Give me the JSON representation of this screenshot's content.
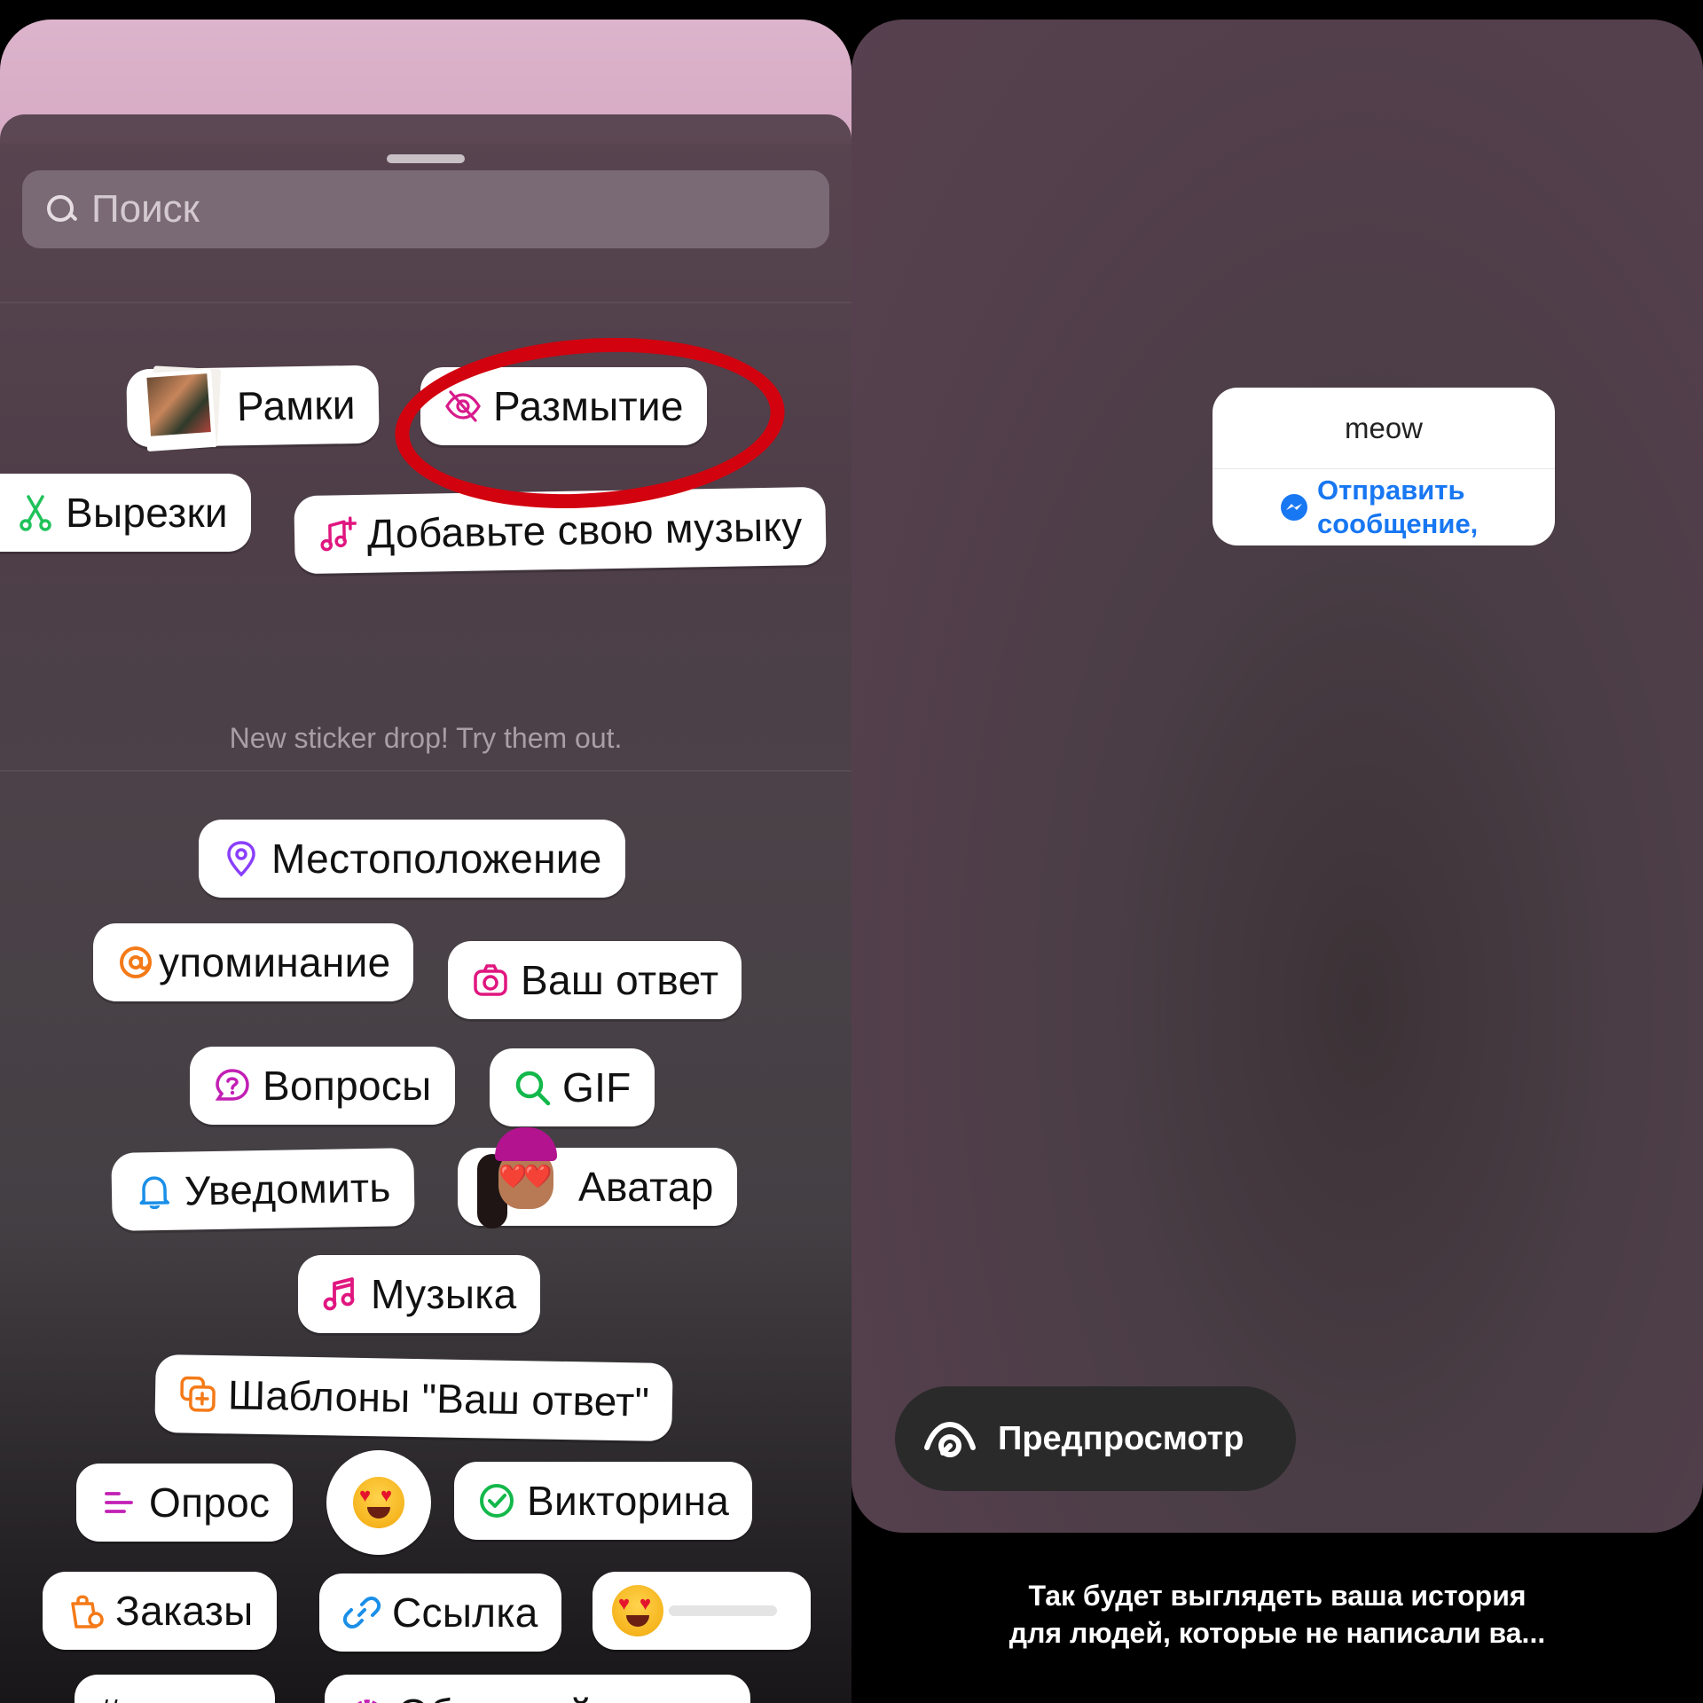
{
  "search": {
    "placeholder": "Поиск"
  },
  "top_stickers": {
    "frames": "Рамки",
    "blur": "Размытие",
    "cutouts": "Вырезки",
    "add_music": "Добавьте свою музыку"
  },
  "drop_note": "New sticker drop! Try them out.",
  "stickers": {
    "location": "Местоположение",
    "mention": "упоминание",
    "your_answer": "Ваш ответ",
    "questions": "Вопросы",
    "gif": "GIF",
    "notify": "Уведомить",
    "avatar": "Аватар",
    "music": "Музыка",
    "templates": "Шаблоны \"Ваш ответ\"",
    "poll": "Опрос",
    "quiz": "Викторина",
    "orders": "Заказы",
    "link": "Ссылка",
    "hashtag": "#хэштег",
    "countdown": "Обратный отсчет"
  },
  "preview": {
    "question": "meow",
    "send_line1": "Отправить",
    "send_line2": "сообщение,",
    "button": "Предпросмотр",
    "caption_line1": "Так будет выглядеть ваша история",
    "caption_line2": "для людей, которые не написали ва..."
  },
  "colors": {
    "highlight_ring": "#d2020f",
    "link_blue": "#1877f2"
  }
}
